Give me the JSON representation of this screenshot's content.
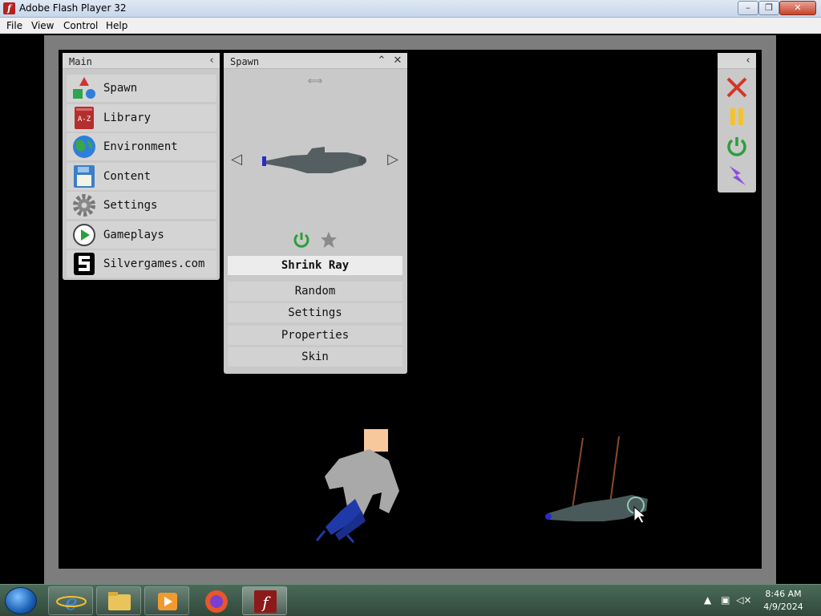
{
  "window": {
    "title": "Adobe Flash Player 32",
    "app_icon": "f",
    "minimize": "–",
    "maximize": "❐",
    "close": "✕"
  },
  "menu": [
    "File",
    "View",
    "Control",
    "Help"
  ],
  "main_panel": {
    "title": "Main",
    "collapse_icon": "‹",
    "items": [
      {
        "label": "Spawn",
        "icon": "shapes-icon"
      },
      {
        "label": "Library",
        "icon": "az-book-icon"
      },
      {
        "label": "Environment",
        "icon": "globe-icon"
      },
      {
        "label": "Content",
        "icon": "floppy-disk-icon"
      },
      {
        "label": "Settings",
        "icon": "gear-icon"
      },
      {
        "label": "Gameplays",
        "icon": "play-circle-icon"
      },
      {
        "label": "Silvergames.com",
        "icon": "silvergames-logo-icon"
      }
    ]
  },
  "spawn_panel": {
    "title": "Spawn",
    "up_icon": "⌃",
    "close_icon": "✕",
    "swap_icon": "⟺",
    "prev_icon": "◁",
    "next_icon": "▷",
    "selected": "Shrink Ray",
    "buttons": [
      "Random",
      "Settings",
      "Properties",
      "Skin"
    ]
  },
  "tool_panel": {
    "collapse_icon": "‹"
  },
  "taskbar": {
    "time": "8:46 AM",
    "date": "4/9/2024"
  },
  "colors": {
    "stage_bg": "#000000",
    "panel_bg": "#c9c9c9",
    "accent_green": "#2e9e3a",
    "tool_red": "#d6342a",
    "tool_yellow": "#f2c230",
    "tool_purple": "#8a4fe0"
  }
}
